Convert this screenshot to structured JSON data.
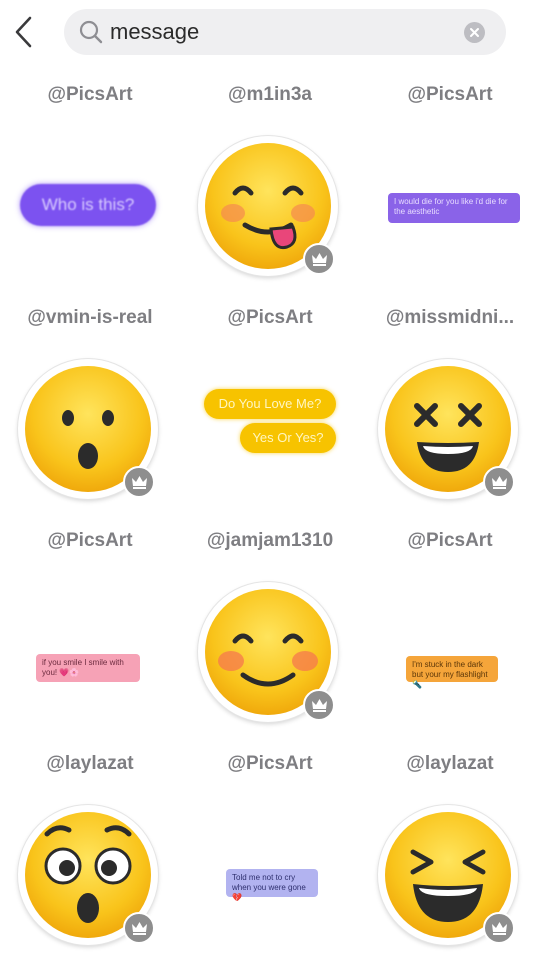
{
  "search": {
    "query": "message"
  },
  "cells": [
    {
      "author": "@PicsArt",
      "kind": "bubble-big",
      "text": "Who is this?"
    },
    {
      "author": "@m1in3a",
      "kind": "emoji",
      "emoji": "tongue-out-emoji",
      "premium": true
    },
    {
      "author": "@PicsArt",
      "kind": "bubble-purple",
      "text": "I would die for you like i'd die for the aesthetic"
    },
    {
      "author": "@vmin-is-real",
      "kind": "emoji",
      "emoji": "surprised-emoji",
      "premium": true
    },
    {
      "author": "@PicsArt",
      "kind": "bubble-yellow",
      "text": "Do You Love Me?",
      "text2": "Yes Or Yes?"
    },
    {
      "author": "@missmidni...",
      "kind": "emoji",
      "emoji": "x-eyes-emoji",
      "premium": true
    },
    {
      "author": "@PicsArt",
      "kind": "bubble-pink",
      "text": "if you smile I smile with you! 💗🌸"
    },
    {
      "author": "@jamjam1310",
      "kind": "emoji",
      "emoji": "blushing-smile-emoji",
      "premium": true
    },
    {
      "author": "@PicsArt",
      "kind": "bubble-orange",
      "text": "I'm stuck in the dark but your my flashlight 🔦"
    },
    {
      "author": "@laylazat",
      "kind": "emoji",
      "emoji": "shocked-emoji",
      "premium": true
    },
    {
      "author": "@PicsArt",
      "kind": "bubble-lav",
      "text": "Told me not to cry when you were gone 💔"
    },
    {
      "author": "@laylazat",
      "kind": "emoji",
      "emoji": "laughing-emoji",
      "premium": true
    }
  ],
  "colors": {
    "emoji_face": "#f9c41b",
    "bubble_purple": "#7c52f0",
    "bubble_yellow": "#f7c300",
    "bubble_pink": "#f6a2b6",
    "bubble_orange": "#f5a53a",
    "bubble_lavender": "#b2b3f0",
    "author_text": "#7e7e82"
  }
}
